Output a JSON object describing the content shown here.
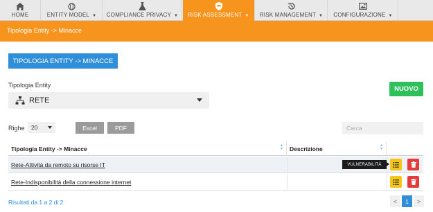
{
  "nav": {
    "items": [
      {
        "label": "HOME",
        "icon": "home-icon",
        "caret": false,
        "active": false
      },
      {
        "label": "ENTITY MODEL",
        "icon": "globe-icon",
        "caret": true,
        "active": false
      },
      {
        "label": "COMPLIANCE PRIVACY",
        "icon": "flask-icon",
        "caret": true,
        "active": false
      },
      {
        "label": "RISK ASSESSMENT",
        "icon": "shield-icon",
        "caret": true,
        "active": true
      },
      {
        "label": "RISK MANAGEMENT",
        "icon": "history-icon",
        "caret": true,
        "active": false
      },
      {
        "label": "CONFIGURAZIONE",
        "icon": "image-icon",
        "caret": true,
        "active": false
      }
    ]
  },
  "breadcrumb": "Tipologia Entity -> Minacce",
  "tab_label": "TIPOLOGIA ENTITY -> MINACCE",
  "filter": {
    "label": "Tipologia Entity",
    "selected": "RETE"
  },
  "new_button": "NUOVO",
  "controls": {
    "rows_label": "Righe",
    "rows_value": "20",
    "excel": "Excel",
    "pdf": "PDF",
    "search_placeholder": "Cerca"
  },
  "table": {
    "headers": [
      "Tipologia Entity -> Minacce",
      "Descrizione"
    ],
    "rows": [
      {
        "name": "Rete-Attività da remoto su risorse IT",
        "description": ""
      },
      {
        "name": "Rete-Indisponibilità della connessione internet",
        "description": ""
      }
    ]
  },
  "tooltip": "VULNERABILITÀ",
  "footer": {
    "results": "Risultati da 1 a 2 di 2",
    "prev": "<",
    "page": "1",
    "next": ">"
  },
  "colors": {
    "accent_orange": "#f7941d",
    "primary_blue": "#2f8fd8",
    "success_green": "#2ec05b",
    "warning_yellow": "#f5c518",
    "danger_red": "#e63b3b"
  }
}
